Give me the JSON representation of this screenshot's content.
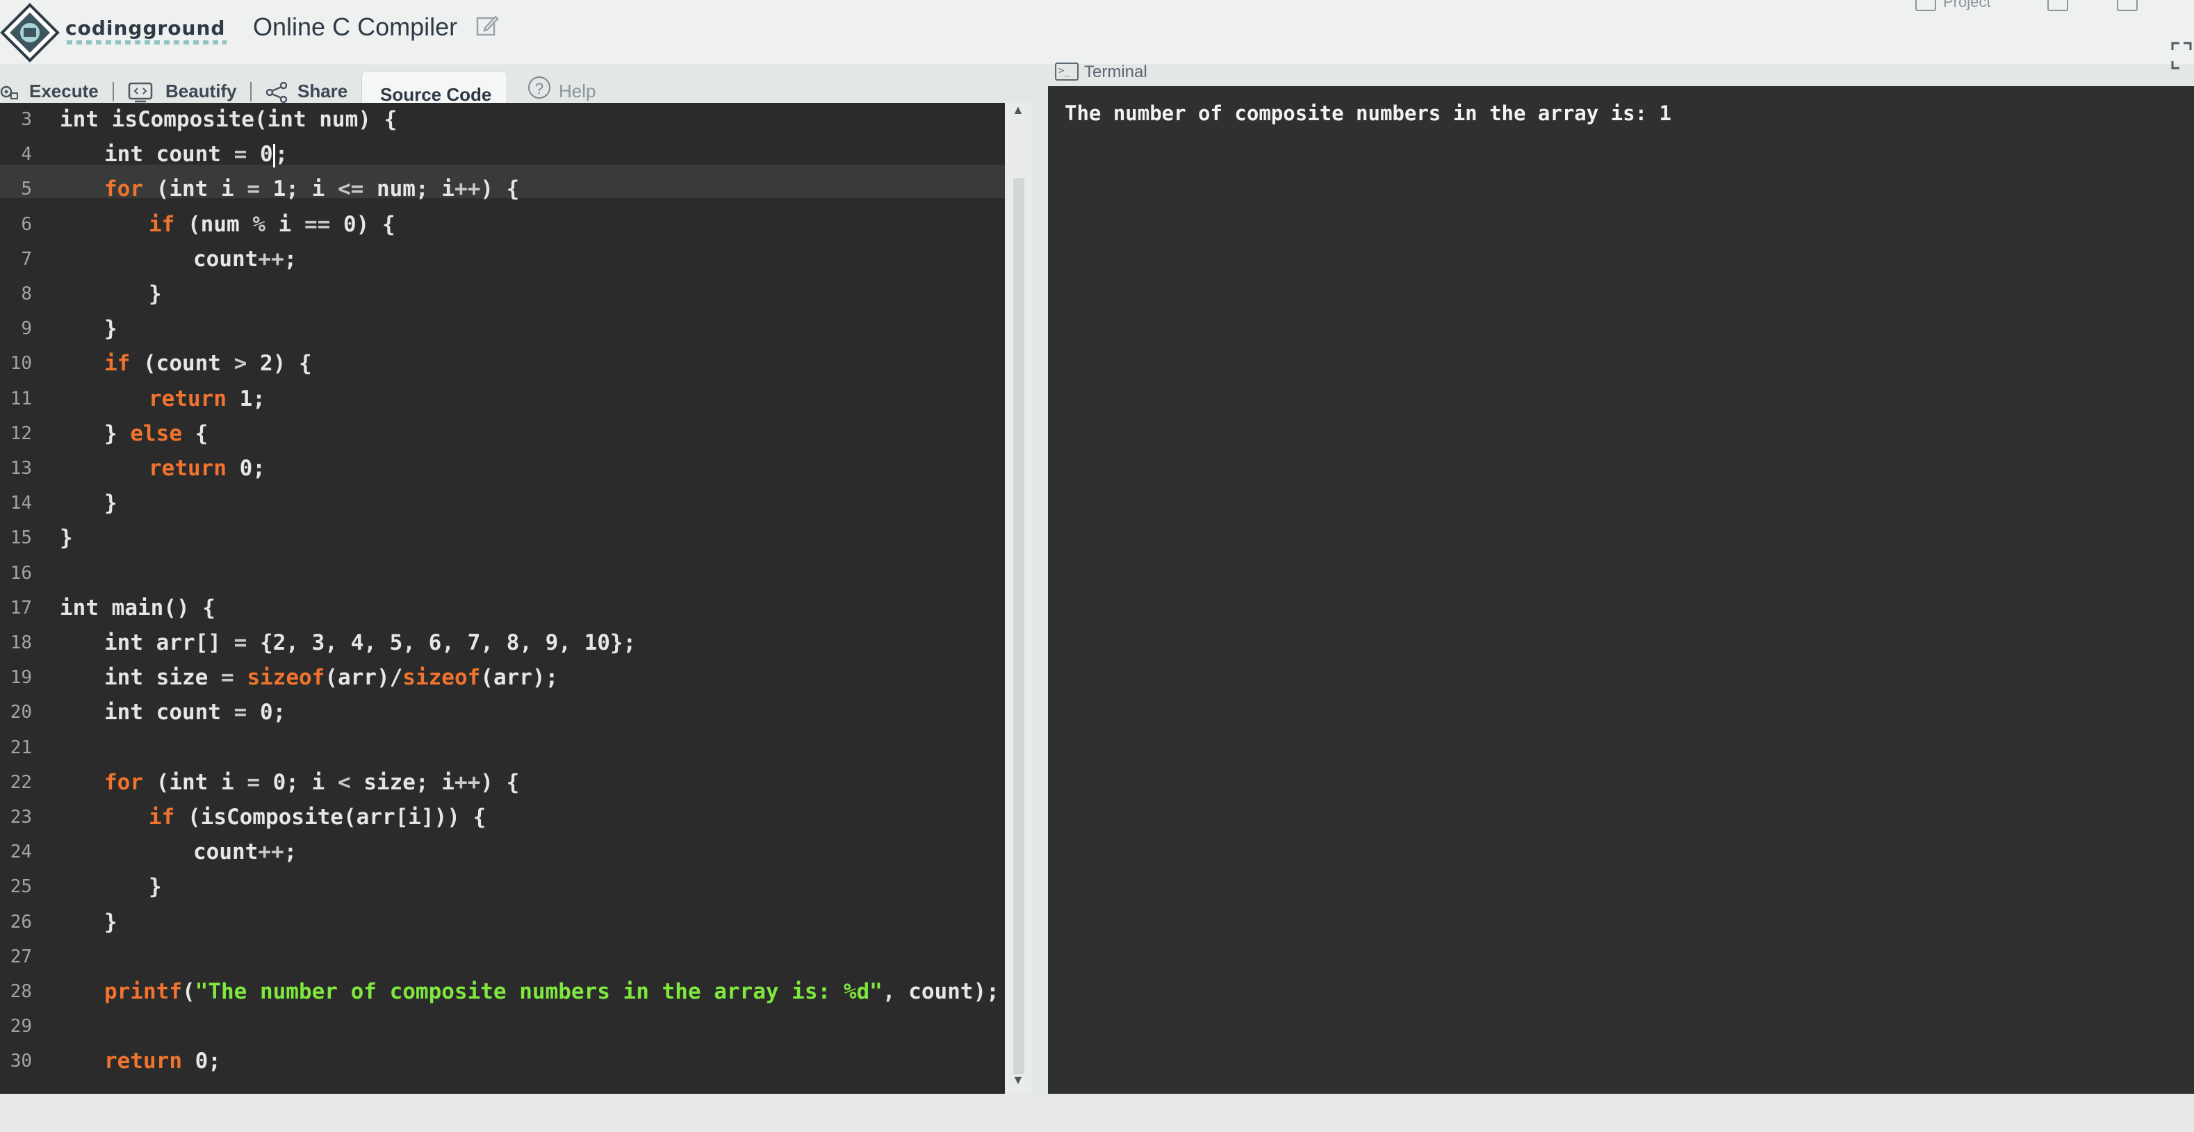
{
  "header": {
    "brand": "codingground",
    "title": "Online C Compiler",
    "project_label": "Project"
  },
  "toolbar": {
    "execute": "Execute",
    "beautify": "Beautify",
    "share": "Share",
    "source_code": "Source Code",
    "help": "Help"
  },
  "terminal": {
    "label": "Terminal",
    "output": "The number of composite numbers in the array is: 1"
  },
  "editor": {
    "cursor_line": 4,
    "lines": [
      {
        "num": "3",
        "indent": 0,
        "text": "int isComposite(int num) {"
      },
      {
        "num": "4",
        "indent": 1,
        "text": "int count = 0;"
      },
      {
        "num": "5",
        "indent": 1,
        "text": "for (int i = 1; i <= num; i++) {"
      },
      {
        "num": "6",
        "indent": 2,
        "text": "if (num % i == 0) {"
      },
      {
        "num": "7",
        "indent": 3,
        "text": "count++;"
      },
      {
        "num": "8",
        "indent": 2,
        "text": "}"
      },
      {
        "num": "9",
        "indent": 1,
        "text": "}"
      },
      {
        "num": "10",
        "indent": 1,
        "text": "if (count > 2) {"
      },
      {
        "num": "11",
        "indent": 2,
        "text": "return 1;"
      },
      {
        "num": "12",
        "indent": 1,
        "text": "} else {"
      },
      {
        "num": "13",
        "indent": 2,
        "text": "return 0;"
      },
      {
        "num": "14",
        "indent": 1,
        "text": "}"
      },
      {
        "num": "15",
        "indent": 0,
        "text": "}"
      },
      {
        "num": "16",
        "indent": 0,
        "text": ""
      },
      {
        "num": "17",
        "indent": 0,
        "text": "int main() {"
      },
      {
        "num": "18",
        "indent": 1,
        "text": "int arr[] = {2, 3, 4, 5, 6, 7, 8, 9, 10};"
      },
      {
        "num": "19",
        "indent": 1,
        "text": "int size = sizeof(arr)/sizeof(arr);"
      },
      {
        "num": "20",
        "indent": 1,
        "text": "int count = 0;"
      },
      {
        "num": "21",
        "indent": 0,
        "text": ""
      },
      {
        "num": "22",
        "indent": 1,
        "text": "for (int i = 0; i < size; i++) {"
      },
      {
        "num": "23",
        "indent": 2,
        "text": "if (isComposite(arr[i])) {"
      },
      {
        "num": "24",
        "indent": 3,
        "text": "count++;"
      },
      {
        "num": "25",
        "indent": 2,
        "text": "}"
      },
      {
        "num": "26",
        "indent": 1,
        "text": "}"
      },
      {
        "num": "27",
        "indent": 0,
        "text": ""
      },
      {
        "num": "28",
        "indent": 1,
        "text": "printf(\"The number of composite numbers in the array is: %d\", count);"
      },
      {
        "num": "29",
        "indent": 0,
        "text": ""
      },
      {
        "num": "30",
        "indent": 1,
        "text": "return 0;"
      }
    ]
  },
  "colors": {
    "editor_bg": "#2b2b2b",
    "terminal_bg": "#2f3130",
    "keyword": "#f1742e",
    "string": "#7fe83e"
  }
}
